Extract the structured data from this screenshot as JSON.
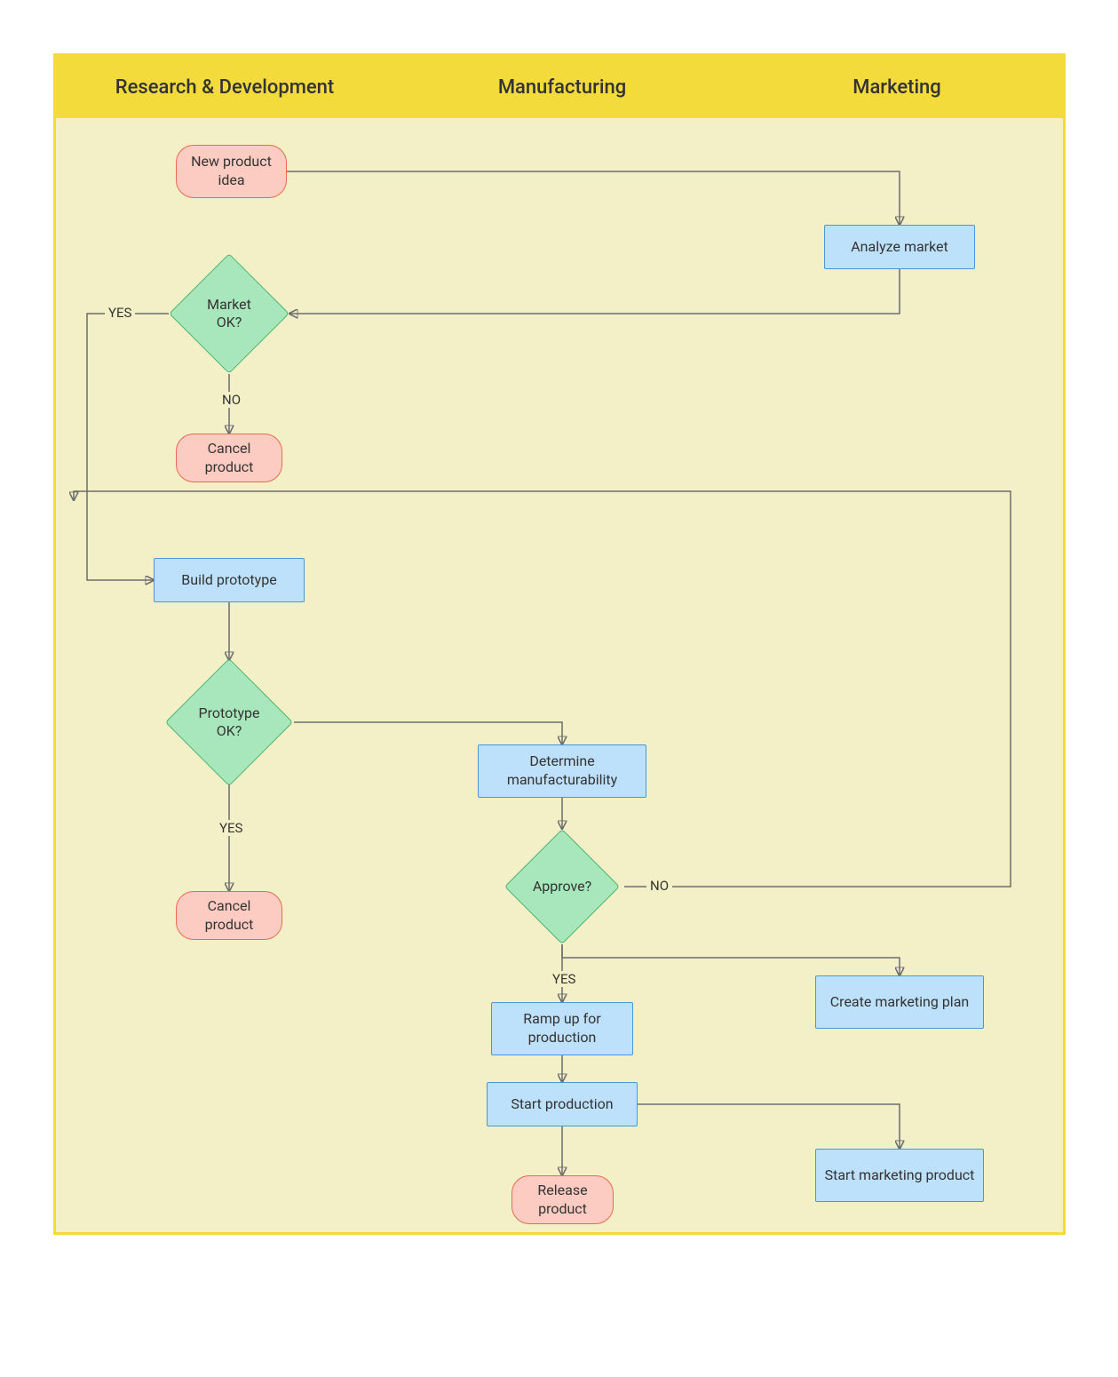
{
  "lanes": {
    "rd": "Research & Development",
    "mfg": "Manufacturing",
    "mkt": "Marketing"
  },
  "nodes": {
    "new_idea": "New product idea",
    "analyze_market": "Analyze market",
    "market_ok": "Market OK?",
    "cancel_product_1": "Cancel product",
    "build_prototype": "Build prototype",
    "prototype_ok": "Prototype OK?",
    "cancel_product_2": "Cancel product",
    "determine_mfg": "Determine manufacturability",
    "approve": "Approve?",
    "ramp_up": "Ramp up for production",
    "start_production": "Start production",
    "create_marketing_plan": "Create marketing plan",
    "start_marketing_product": "Start marketing product",
    "release_product": "Release product"
  },
  "edge_labels": {
    "yes_market": "YES",
    "no_market": "NO",
    "yes_proto_down": "YES",
    "yes_approve": "YES",
    "no_approve": "NO"
  },
  "chart_data": {
    "type": "swimlane-flowchart",
    "lanes": [
      "Research & Development",
      "Manufacturing",
      "Marketing"
    ],
    "nodes": [
      {
        "id": "new_idea",
        "label": "New product idea",
        "type": "terminator",
        "lane": "Research & Development"
      },
      {
        "id": "analyze_market",
        "label": "Analyze market",
        "type": "process",
        "lane": "Marketing"
      },
      {
        "id": "market_ok",
        "label": "Market OK?",
        "type": "decision",
        "lane": "Research & Development"
      },
      {
        "id": "cancel_product_1",
        "label": "Cancel product",
        "type": "terminator",
        "lane": "Research & Development"
      },
      {
        "id": "build_prototype",
        "label": "Build prototype",
        "type": "process",
        "lane": "Research & Development"
      },
      {
        "id": "prototype_ok",
        "label": "Prototype OK?",
        "type": "decision",
        "lane": "Research & Development"
      },
      {
        "id": "cancel_product_2",
        "label": "Cancel product",
        "type": "terminator",
        "lane": "Research & Development"
      },
      {
        "id": "determine_mfg",
        "label": "Determine manufacturability",
        "type": "process",
        "lane": "Manufacturing"
      },
      {
        "id": "approve",
        "label": "Approve?",
        "type": "decision",
        "lane": "Manufacturing"
      },
      {
        "id": "ramp_up",
        "label": "Ramp up for production",
        "type": "process",
        "lane": "Manufacturing"
      },
      {
        "id": "start_production",
        "label": "Start production",
        "type": "process",
        "lane": "Manufacturing"
      },
      {
        "id": "create_marketing_plan",
        "label": "Create marketing plan",
        "type": "process",
        "lane": "Marketing"
      },
      {
        "id": "start_marketing_product",
        "label": "Start marketing product",
        "type": "process",
        "lane": "Marketing"
      },
      {
        "id": "release_product",
        "label": "Release product",
        "type": "terminator",
        "lane": "Manufacturing"
      }
    ],
    "edges": [
      {
        "from": "new_idea",
        "to": "analyze_market"
      },
      {
        "from": "analyze_market",
        "to": "market_ok"
      },
      {
        "from": "market_ok",
        "to": "cancel_product_1",
        "label": "NO"
      },
      {
        "from": "market_ok",
        "to": "build_prototype",
        "label": "YES"
      },
      {
        "from": "build_prototype",
        "to": "prototype_ok"
      },
      {
        "from": "prototype_ok",
        "to": "determine_mfg"
      },
      {
        "from": "prototype_ok",
        "to": "cancel_product_2",
        "label": "YES"
      },
      {
        "from": "determine_mfg",
        "to": "approve"
      },
      {
        "from": "approve",
        "to": "ramp_up",
        "label": "YES"
      },
      {
        "from": "approve",
        "to": "build_prototype",
        "label": "NO"
      },
      {
        "from": "approve",
        "to": "create_marketing_plan"
      },
      {
        "from": "ramp_up",
        "to": "start_production"
      },
      {
        "from": "start_production",
        "to": "start_marketing_product"
      },
      {
        "from": "start_production",
        "to": "release_product"
      }
    ]
  }
}
